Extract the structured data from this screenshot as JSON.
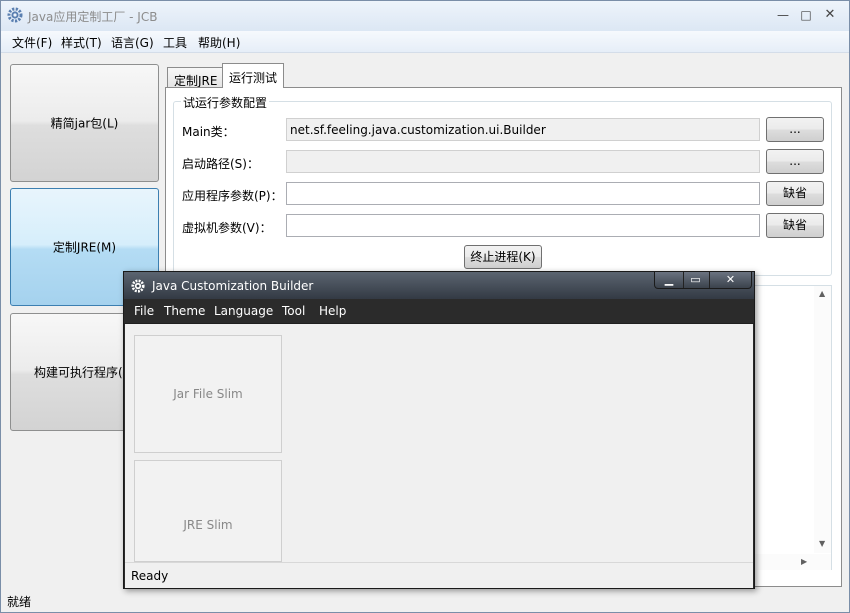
{
  "main_window": {
    "title": "Java应用定制工厂 - JCB",
    "controls": {
      "minimize": "—",
      "maximize": "□",
      "close": "✕"
    },
    "menu": [
      "文件(F)",
      "样式(T)",
      "语言(G)",
      "工具",
      "帮助(H)"
    ],
    "nav": {
      "jar_slim": "精简jar包(L)",
      "custom_jre": "定制JRE(M)",
      "build_exe": "构建可执行程序(E)"
    },
    "tabs": [
      "定制JRE",
      "运行测试"
    ],
    "run_params": {
      "group_title": "试运行参数配置",
      "main_class_label": "Main类：",
      "main_class_value": "net.sf.feeling.java.customization.ui.Builder",
      "classpath_label": "启动路径(S)：",
      "classpath_value": "",
      "app_args_label": "应用程序参数(P)：",
      "app_args_value": "",
      "vm_args_label": "虚拟机参数(V)：",
      "vm_args_value": "",
      "browse_label": "...",
      "default_label": "缺省",
      "stop_label": "终止进程(K)"
    },
    "status": "就绪"
  },
  "overlay_window": {
    "title": "Java Customization Builder",
    "menu": [
      "File",
      "Theme",
      "Language",
      "Tool",
      "Help"
    ],
    "cards": [
      "Jar File Slim",
      "JRE Slim"
    ],
    "status": "Ready"
  },
  "colors": {
    "accent_selected": "#a5d2ee",
    "overlay_dark": "#2b2b2b"
  }
}
